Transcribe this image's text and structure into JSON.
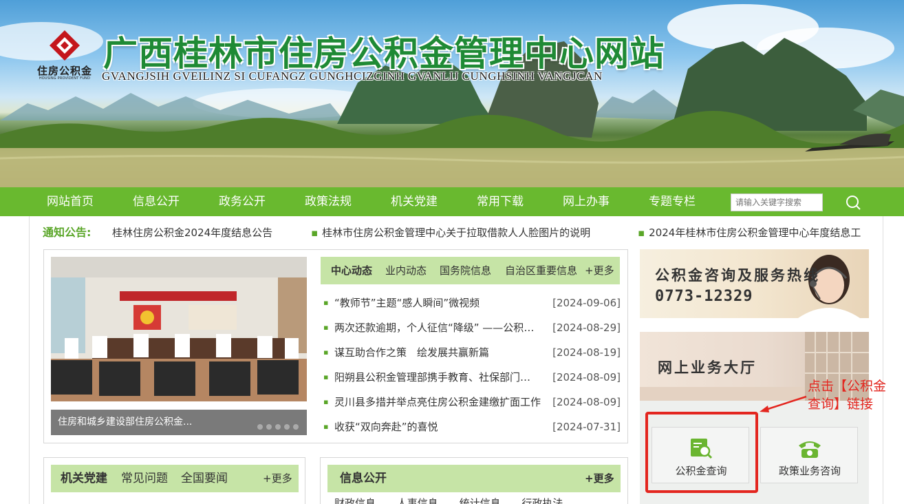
{
  "header": {
    "logo_text": "住房公积金",
    "logo_sub": "HOUSING PROVIDENT FUND",
    "title": "广西桂林市住房公积金管理中心网站",
    "subtitle": "GVANGJSIH GVEILINZ SI CUFANGZ GUNGHCIZGINH GVANLIJ CUNGHSINH VANGJCAN"
  },
  "nav": {
    "items": [
      "网站首页",
      "信息公开",
      "政务公开",
      "政策法规",
      "机关党建",
      "常用下载",
      "网上办事",
      "专题专栏"
    ],
    "search_placeholder": "请输入关键字搜索"
  },
  "notice": {
    "label": "通知公告:",
    "items": [
      "桂林住房公积金2024年度结息公告",
      "桂林市住房公积金管理中心关于拉取借款人人脸图片的说明",
      "2024年桂林市住房公积金管理中心年度结息工"
    ]
  },
  "slider": {
    "caption": "住房和城乡建设部住房公积金..."
  },
  "center_news": {
    "tabs": [
      "中心动态",
      "业内动态",
      "国务院信息",
      "自治区重要信息"
    ],
    "more": "+更多",
    "rows": [
      {
        "title": "“教师节”主题“感人瞬间”微视频",
        "date": "[2024-09-06]"
      },
      {
        "title": "两次还款逾期，个人征信“降级” ——公积金贷款逾期的后果",
        "date": "[2024-08-29]"
      },
      {
        "title": "谋互助合作之策　绘发展共赢新篇",
        "date": "[2024-08-19]"
      },
      {
        "title": "阳朔县公积金管理部携手教育、社保部门联合开展宣传",
        "date": "[2024-08-09]"
      },
      {
        "title": "灵川县多措并举点亮住房公积金建缴扩面工作",
        "date": "[2024-08-09]"
      },
      {
        "title": "收获“双向奔赴”的喜悦",
        "date": "[2024-07-31]"
      }
    ]
  },
  "party_box": {
    "tabs": [
      "机关党建",
      "常见问题",
      "全国要闻"
    ],
    "more": "+更多"
  },
  "info_box": {
    "tabs": [
      "信息公开"
    ],
    "more": "+更多",
    "subtabs": [
      "财政信息",
      "人事信息",
      "统计信息",
      "行政执法"
    ]
  },
  "right": {
    "hotline_title": "公积金咨询及服务热线",
    "hotline_number": "0773-12329",
    "online_title": "网上业务大厅",
    "services": [
      "公积金查询",
      "政策业务咨询"
    ],
    "annotation_line1": "点击【公积金",
    "annotation_line2": "查询】链接"
  },
  "colors": {
    "nav_green": "#69b92f",
    "title_green": "#1f8a35",
    "tab_bg": "#c6e4a6",
    "highlight_red": "#e3261f"
  }
}
